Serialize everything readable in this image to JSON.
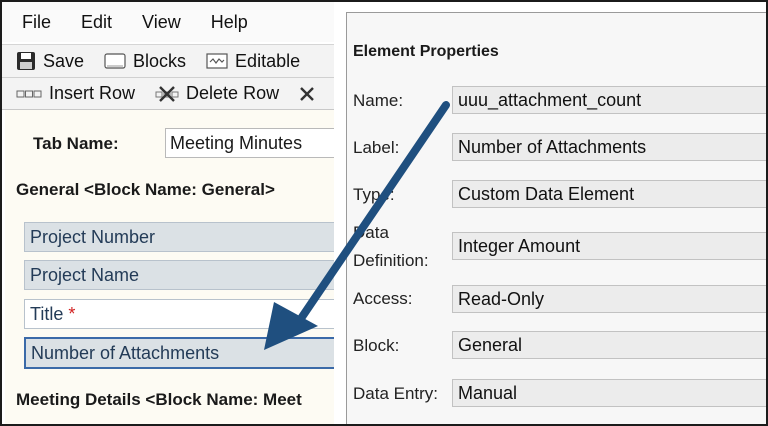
{
  "menu": {
    "items": [
      "File",
      "Edit",
      "View",
      "Help"
    ]
  },
  "toolbar": {
    "save_label": "Save",
    "blocks_label": "Blocks",
    "editable_label": "Editable",
    "insert_row_label": "Insert Row",
    "delete_row_label": "Delete Row"
  },
  "form": {
    "tab_name_label": "Tab Name:",
    "tab_name_value": "Meeting Minutes",
    "section_general": "General <Block Name: General>",
    "fields": {
      "project_number": "Project Number",
      "project_name": "Project Name",
      "title": "Title",
      "title_required_marker": "*",
      "number_of_attachments": "Number of Attachments"
    },
    "section_meeting": "Meeting Details <Block Name: Meet"
  },
  "properties": {
    "title": "Element Properties",
    "name_label": "Name:",
    "name_value": "uuu_attachment_count",
    "label_label": "Label:",
    "label_value": "Number of Attachments",
    "type_label": "Type:",
    "type_value": "Custom Data Element",
    "data_definition_label_line1": "Data",
    "data_definition_label_line2": "Definition:",
    "data_definition_value": "Integer Amount",
    "access_label": "Access:",
    "access_value": "Read-Only",
    "block_label": "Block:",
    "block_value": "General",
    "data_entry_label": "Data Entry:",
    "data_entry_value": "Manual"
  },
  "colors": {
    "arrow": "#1f4f7f",
    "selected_border": "#3b6aa8",
    "field_grey": "#dbe1e5",
    "required": "#d12020"
  }
}
